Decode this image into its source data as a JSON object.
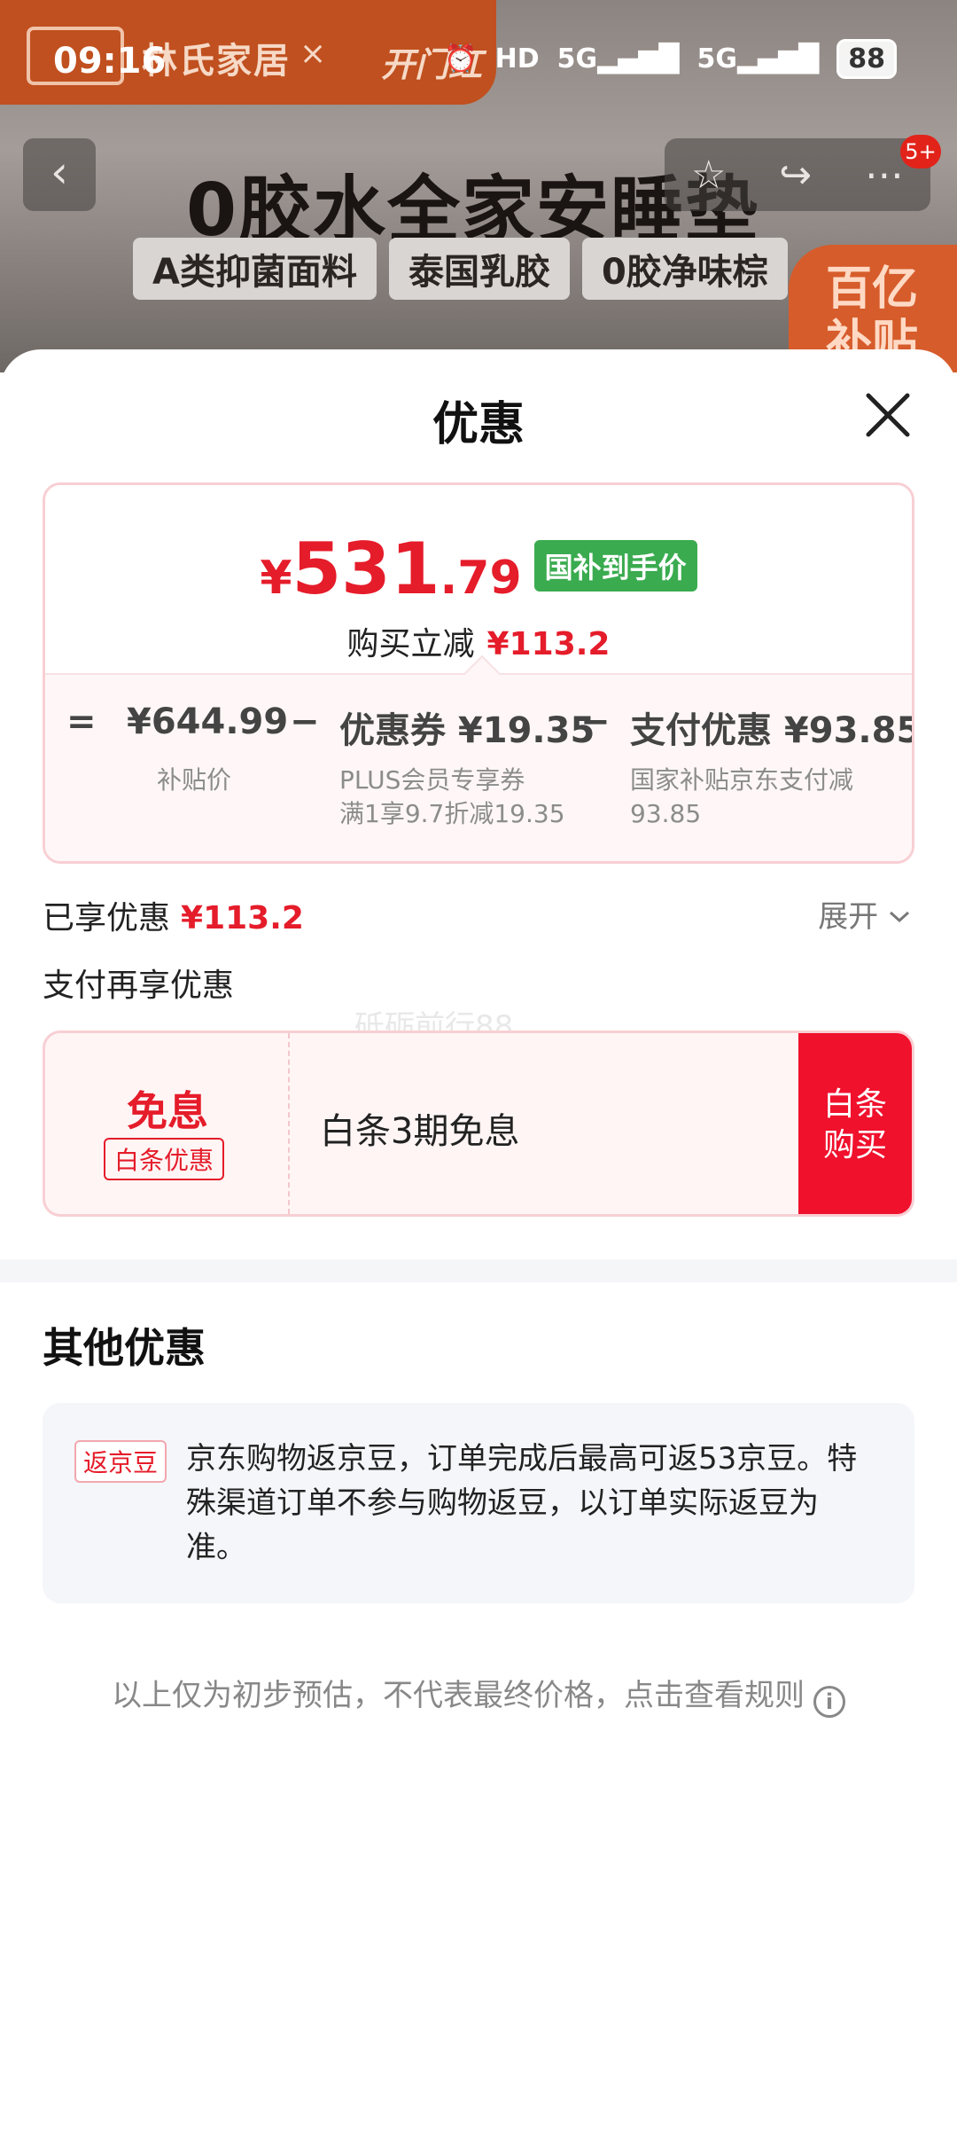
{
  "status_bar": {
    "time": "09:16",
    "battery": "88"
  },
  "background_page": {
    "brand_name": "林氏家居",
    "brand_separator": "×",
    "campaign": "开门红",
    "headline": "0胶水全家安睡垫",
    "tags": [
      "A类抑菌面料",
      "泰国乳胶",
      "0胶净味棕"
    ],
    "badge": "百亿补贴",
    "notification_count": "5+"
  },
  "sheet": {
    "title": "优惠",
    "final_price": {
      "currency": "¥",
      "integer": "531",
      "decimal": ".79",
      "tag": "国补到手价"
    },
    "instant_discount_label": "购买立减",
    "instant_discount_value": "¥113.2",
    "breakdown": {
      "equals": "=",
      "minus1": "−",
      "minus2": "−",
      "base_value": "¥644.99",
      "base_caption": "补贴价",
      "coupon_value": "优惠券 ¥19.35",
      "coupon_caption_line1": "PLUS会员专享券",
      "coupon_caption_line2": "满1享9.7折减19.35",
      "payment_value": "支付优惠 ¥93.85",
      "payment_caption_line1": "国家补贴京东支付减",
      "payment_caption_line2": "93.85"
    },
    "applied_label": "已享优惠",
    "applied_value": "¥113.2",
    "expand_label": "展开",
    "pay_more_label": "支付再享优惠",
    "watermark": "砥砺前行88",
    "baitiao": {
      "free_label": "免息",
      "badge": "白条优惠",
      "description": "白条3期免息",
      "button_line1": "白条",
      "button_line2": "购买"
    },
    "other_title": "其他优惠",
    "bean": {
      "badge": "返京豆",
      "text": "京东购物返京豆，订单完成后最高可返53京豆。特殊渠道订单不参与购物返豆，以订单实际返豆为准。"
    },
    "footer_note": "以上仅为初步预估，不代表最终价格，点击查看规则"
  },
  "colors": {
    "accent_red": "#e51c2a",
    "button_red": "#f0112d",
    "green_tag": "#3aab4f"
  }
}
